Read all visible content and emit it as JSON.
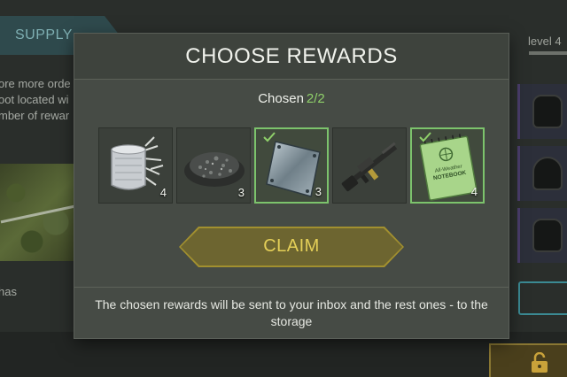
{
  "background": {
    "tab_label": "SUPPLY",
    "description_lines": [
      "ore more orde",
      "oot located wi",
      "mber of rewar"
    ],
    "map_label": "has",
    "level_label": "level 4"
  },
  "modal": {
    "title": "CHOOSE REWARDS",
    "chosen_label": "Chosen",
    "chosen_count": "2/2",
    "rewards": [
      {
        "icon": "aluminum-tape-and-metal-scraps-icon",
        "quantity": "4",
        "selected": false
      },
      {
        "icon": "crushed-stone-icon",
        "quantity": "3",
        "selected": false
      },
      {
        "icon": "steel-plate-icon",
        "quantity": "3",
        "selected": true
      },
      {
        "icon": "rifle-icon",
        "quantity": "",
        "selected": false
      },
      {
        "icon": "notebook-icon",
        "quantity": "4",
        "selected": true
      }
    ],
    "notebook_text": [
      "All-Weather",
      "NOTEBOOK"
    ],
    "claim_label": "CLAIM",
    "note": "The chosen rewards will be sent to your inbox and the rest ones - to the storage"
  },
  "colors": {
    "accent_green": "#8fd06a",
    "claim_gold": "#e4cf58",
    "selected_border": "#7cc36c"
  }
}
